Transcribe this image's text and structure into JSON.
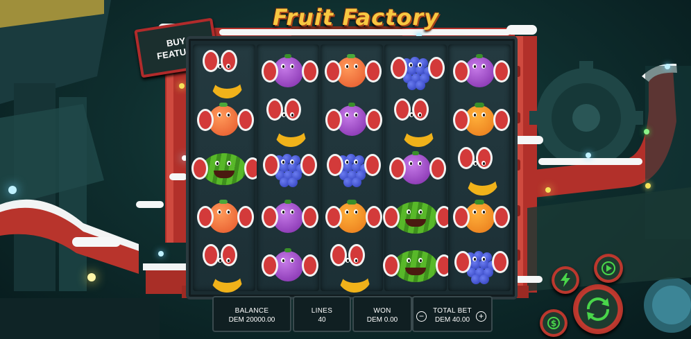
{
  "game": {
    "title": "Fruit Factory",
    "buy_feature_label": "BUY\nFEATURE"
  },
  "reels": [
    [
      "banana",
      "orange-fuzzy",
      "watermelon",
      "orange-fuzzy",
      "banana"
    ],
    [
      "plum",
      "banana",
      "grapes",
      "plum",
      "plum"
    ],
    [
      "orange-fuzzy",
      "plum",
      "grapes",
      "orange",
      "banana"
    ],
    [
      "grapes",
      "banana",
      "plum",
      "watermelon",
      "watermelon"
    ],
    [
      "plum",
      "orange",
      "banana",
      "orange",
      "grapes"
    ]
  ],
  "bottom_bar": {
    "balance": {
      "label": "BALANCE",
      "value": "DEM 20000.00"
    },
    "lines": {
      "label": "LINES",
      "value": "40"
    },
    "won": {
      "label": "WON",
      "value": "DEM 0.00"
    },
    "total_bet": {
      "label": "TOTAL BET",
      "value": "DEM 40.00",
      "minus": "−",
      "plus": "+"
    }
  },
  "controls": {
    "spin_icon": "spin-arrows-icon",
    "turbo_icon": "lightning-icon",
    "autoplay_icon": "play-icon",
    "coin_icon": "dollar-coin-icon"
  },
  "colors": {
    "accent_red": "#c43b30",
    "title_gold": "#f7c842",
    "icon_green": "#49d64a"
  }
}
